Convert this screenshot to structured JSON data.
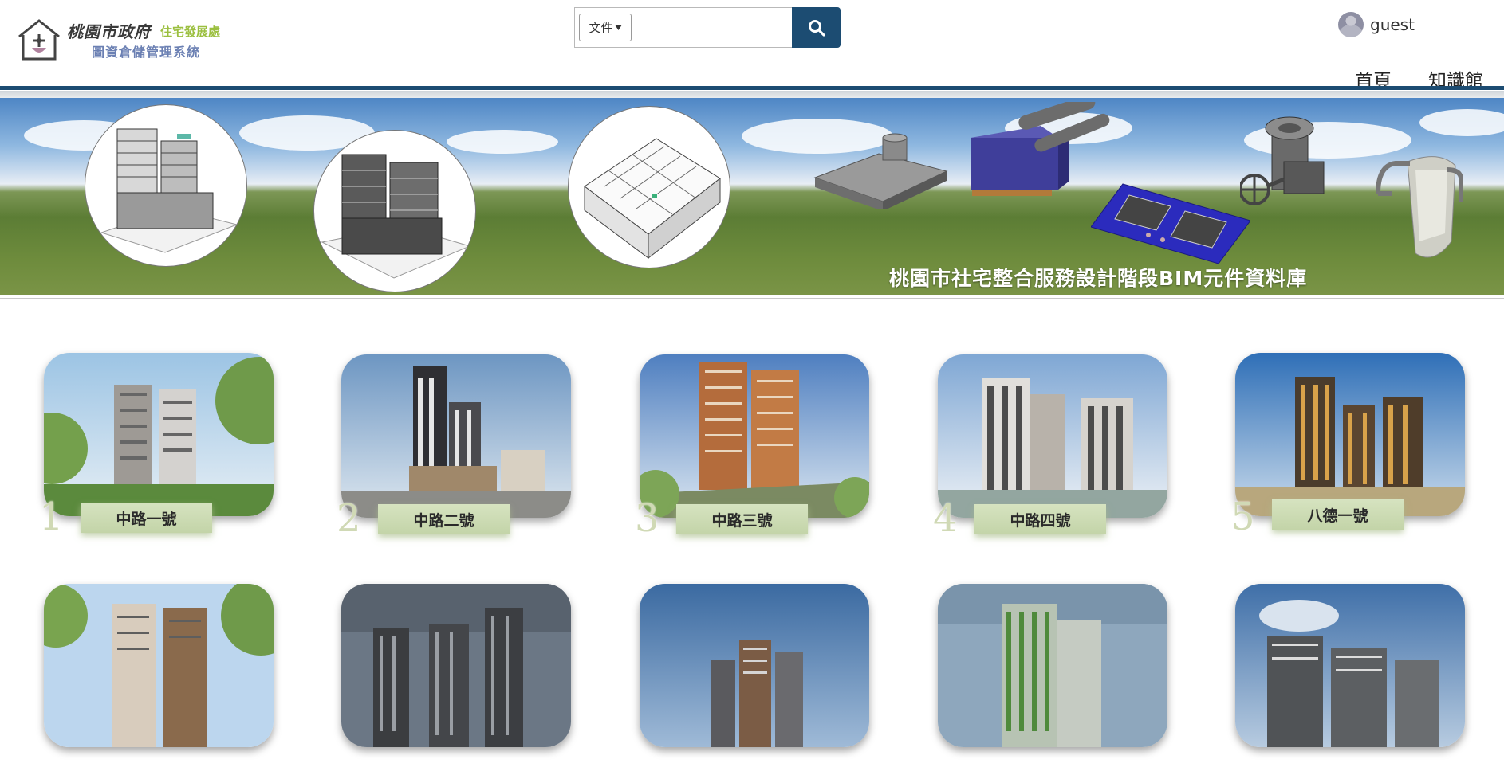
{
  "header": {
    "logo": {
      "city": "桃園市政府",
      "department": "住宅發展處",
      "system": "圖資倉儲管理系統"
    },
    "search": {
      "type_selected": "文件",
      "placeholder": "",
      "button_icon": "search-icon"
    },
    "user": {
      "name": "guest",
      "avatar_icon": "user-avatar-icon"
    },
    "nav": [
      {
        "label": "首頁"
      },
      {
        "label": "知識館"
      }
    ]
  },
  "banner": {
    "title": "桃園市社宅整合服務設計階段BIM元件資料庫"
  },
  "projects": [
    {
      "number": "1",
      "name": "中路一號"
    },
    {
      "number": "2",
      "name": "中路二號"
    },
    {
      "number": "3",
      "name": "中路三號"
    },
    {
      "number": "4",
      "name": "中路四號"
    },
    {
      "number": "5",
      "name": "八德一號"
    }
  ],
  "colors": {
    "primary": "#1c4c72",
    "logo_green": "#9bbf3f",
    "logo_blue": "#6b80b3",
    "label_bg": "#c9d9ae"
  }
}
